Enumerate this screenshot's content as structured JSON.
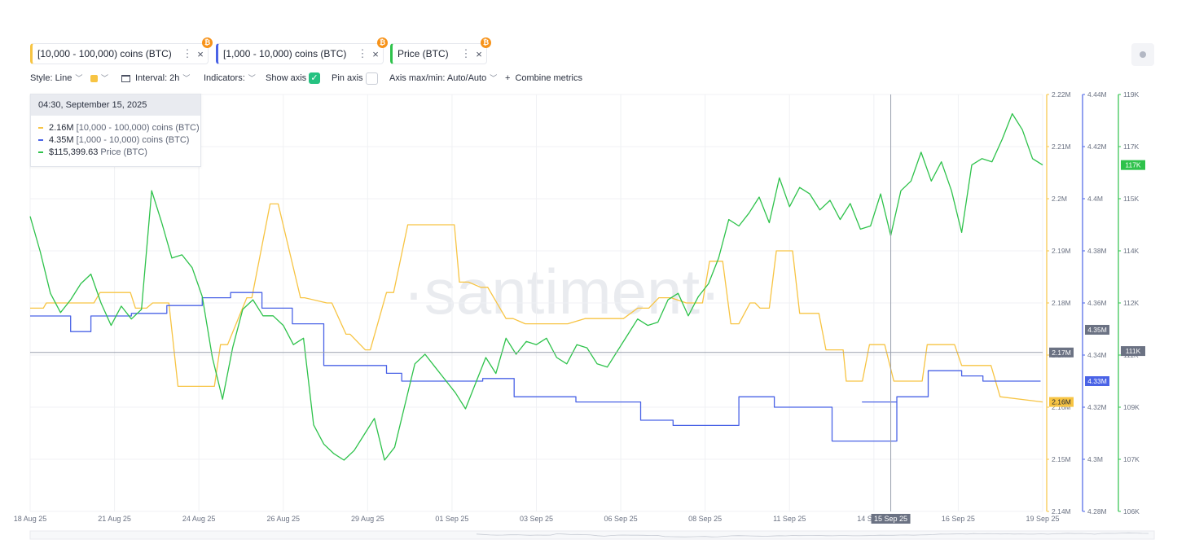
{
  "tabs": [
    {
      "label": "[10,000 - 100,000) coins (BTC)",
      "color": "#f7c443",
      "badge": "₿"
    },
    {
      "label": "[1,000 - 10,000) coins (BTC)",
      "color": "#4a63e6",
      "badge": "₿"
    },
    {
      "label": "Price (BTC)",
      "color": "#2ec24b",
      "badge": "₿"
    }
  ],
  "toolbar": {
    "style": "Style: Line",
    "interval": "Interval: 2h",
    "indicators": "Indicators:",
    "show_axis": "Show axis",
    "pin_axis": "Pin axis",
    "axis_maxmin": "Axis max/min: Auto/Auto",
    "combine": "Combine metrics"
  },
  "watermark": "·santiment·",
  "tooltip": {
    "date": "04:30, September 15, 2025",
    "rows": [
      {
        "value": "2.16M",
        "name": "[10,000 - 100,000) coins (BTC)",
        "color": "#f7c443"
      },
      {
        "value": "4.35M",
        "name": "[1,000 - 10,000) coins (BTC)",
        "color": "#4a63e6"
      },
      {
        "value": "$115,399.63",
        "name": "Price (BTC)",
        "color": "#2ec24b"
      }
    ]
  },
  "chart_data": {
    "type": "line",
    "x_ticks": [
      "18 Aug 25",
      "21 Aug 25",
      "24 Aug 25",
      "26 Aug 25",
      "29 Aug 25",
      "01 Sep 25",
      "03 Sep 25",
      "06 Sep 25",
      "08 Sep 25",
      "11 Sep 25",
      "14 Sep 25",
      "16 Sep 25",
      "19 Sep 25"
    ],
    "x_range": [
      "2025-08-18",
      "2025-09-19"
    ],
    "crosshair_label": "15 Sep 25",
    "axes": [
      {
        "series": "[10,000 - 100,000) coins (BTC)",
        "color": "#f7c443",
        "ticks": [
          "2.22M",
          "2.21M",
          "2.2M",
          "2.19M",
          "2.18M",
          "2.17M",
          "2.16M",
          "2.15M",
          "2.14M"
        ],
        "range": [
          2.14,
          2.22
        ],
        "unit": "M",
        "current": "2.16M",
        "crosshair": "2.17M"
      },
      {
        "series": "[1,000 - 10,000) coins (BTC)",
        "color": "#4a63e6",
        "ticks": [
          "4.44M",
          "4.42M",
          "4.4M",
          "4.38M",
          "4.36M",
          "4.34M",
          "4.32M",
          "4.3M",
          "4.28M"
        ],
        "range": [
          4.28,
          4.44
        ],
        "unit": "M",
        "current": "4.33M",
        "crosshair": "4.35M"
      },
      {
        "series": "Price (BTC)",
        "color": "#2ec24b",
        "ticks": [
          "119K",
          "117K",
          "115K",
          "114K",
          "112K",
          "111K",
          "109K",
          "107K",
          "106K"
        ],
        "range": [
          106,
          119
        ],
        "unit": "K",
        "current": "117K",
        "crosshair": "111K"
      }
    ],
    "series": [
      {
        "name": "[10,000 - 100,000) coins (BTC)",
        "color": "#f7c443",
        "axis": 0,
        "x": [
          0,
          1.3,
          1.6,
          4.5,
          5.1,
          6.3,
          6.9,
          9.9,
          10.4,
          11.5,
          12.1,
          13.7,
          14.6,
          15.9,
          16.9,
          18.2,
          18.8,
          19.5,
          21.4,
          21.9,
          23.7,
          24.5,
          26.7,
          27.1,
          29.3,
          29.8,
          31.2,
          31.6,
          33.1,
          33.6,
          35.2,
          35.9,
          37.3,
          37.8,
          38.9,
          39.6,
          40.4,
          41.9,
          42.4,
          43.3,
          44.5,
          45.2,
          47.0,
          47.7,
          48.9,
          49.3,
          52.8,
          53.1,
          54.8,
          55.2,
          57.5,
          58.6,
          60.0,
          61.1,
          62.1,
          63.3,
          64.8,
          66.4,
          67.1,
          68.4,
          69.2,
          70.0,
          71.1,
          71.6,
          72.1,
          73.0,
          73.7,
          75.3,
          76.0,
          77.9,
          78.6,
          80.3,
          80.6,
          82.2,
          82.9,
          84.4,
          85.3,
          88.1,
          88.6,
          91.3,
          92.0,
          94.9,
          95.8,
          100
        ],
        "y": [
          2.179,
          2.179,
          2.18,
          2.18,
          2.18,
          2.18,
          2.182,
          2.182,
          2.179,
          2.179,
          2.18,
          2.18,
          2.164,
          2.164,
          2.164,
          2.164,
          2.172,
          2.172,
          2.181,
          2.181,
          2.199,
          2.199,
          2.181,
          2.181,
          2.18,
          2.18,
          2.174,
          2.174,
          2.171,
          2.171,
          2.182,
          2.182,
          2.195,
          2.195,
          2.195,
          2.195,
          2.195,
          2.195,
          2.184,
          2.184,
          2.183,
          2.183,
          2.177,
          2.177,
          2.176,
          2.176,
          2.176,
          2.176,
          2.177,
          2.177,
          2.177,
          2.177,
          2.179,
          2.179,
          2.181,
          2.181,
          2.18,
          2.18,
          2.188,
          2.188,
          2.176,
          2.176,
          2.18,
          2.18,
          2.179,
          2.179,
          2.19,
          2.19,
          2.178,
          2.178,
          2.171,
          2.171,
          2.165,
          2.165,
          2.172,
          2.172,
          2.165,
          2.165,
          2.172,
          2.172,
          2.168,
          2.168,
          2.162,
          2.161
        ]
      },
      {
        "name": "[1,000 - 10,000) coins (BTC)",
        "color": "#4a63e6",
        "axis": 1,
        "x": [
          0,
          4.0,
          4.0,
          6.0,
          6.0,
          10.0,
          10.0,
          13.5,
          13.5,
          17.0,
          17.0,
          19.8,
          19.8,
          22.9,
          22.9,
          25.9,
          25.9,
          29.0,
          29.0,
          35.2,
          35.2,
          36.7,
          36.7,
          44.7,
          44.7,
          47.8,
          47.8,
          53.9,
          53.9,
          60.3,
          60.3,
          60.9,
          60.9,
          63.5,
          63.5,
          66.8,
          66.8,
          70.0,
          70.0,
          73.5,
          73.5,
          79.2,
          79.2,
          82.4,
          82.4,
          85.6,
          85.6,
          82.2,
          82.2,
          85.6,
          85.6,
          88.7,
          88.7,
          91.2,
          91.2,
          92.0,
          92.0,
          94.1,
          94.1,
          99.8
        ],
        "y": [
          4.355,
          4.355,
          4.349,
          4.349,
          4.355,
          4.355,
          4.356,
          4.356,
          4.359,
          4.359,
          4.362,
          4.362,
          4.364,
          4.364,
          4.358,
          4.358,
          4.352,
          4.352,
          4.336,
          4.336,
          4.333,
          4.333,
          4.33,
          4.33,
          4.331,
          4.331,
          4.324,
          4.324,
          4.322,
          4.322,
          4.315,
          4.315,
          4.315,
          4.315,
          4.313,
          4.313,
          4.313,
          4.313,
          4.324,
          4.324,
          4.32,
          4.32,
          4.307,
          4.307,
          4.307,
          4.307,
          4.322,
          4.322,
          4.322,
          4.322,
          4.324,
          4.324,
          4.334,
          4.334,
          4.334,
          4.334,
          4.332,
          4.332,
          4.33,
          4.33
        ]
      },
      {
        "name": "Price (BTC)",
        "color": "#2ec24b",
        "axis": 2,
        "x": [
          0,
          1,
          2,
          3,
          4,
          5,
          6,
          7,
          8,
          9,
          10,
          11,
          12,
          13,
          14,
          15,
          16,
          17,
          18,
          19,
          20,
          21,
          22,
          23,
          24,
          25,
          26,
          27,
          28,
          29,
          30,
          31,
          32,
          33,
          34,
          35,
          36,
          37,
          38,
          39,
          40,
          41,
          42,
          43,
          44,
          45,
          46,
          47,
          48,
          49,
          50,
          51,
          52,
          53,
          54,
          55,
          56,
          57,
          58,
          59,
          60,
          61,
          62,
          63,
          64,
          65,
          66,
          67,
          68,
          69,
          70,
          71,
          72,
          73,
          74,
          75,
          76,
          77,
          78,
          79,
          80,
          81,
          82,
          83,
          84,
          85,
          86,
          87,
          88,
          89,
          90,
          91,
          92,
          93,
          94,
          95,
          96,
          97,
          98,
          99,
          100
        ],
        "y": [
          115.2,
          114.1,
          112.8,
          112.2,
          112.6,
          113.1,
          113.4,
          112.5,
          111.8,
          112.4,
          112.0,
          112.3,
          116.0,
          115.0,
          113.9,
          114.0,
          113.6,
          112.7,
          110.8,
          109.5,
          111.1,
          112.3,
          112.6,
          112.1,
          112.1,
          111.8,
          111.2,
          111.4,
          108.7,
          108.1,
          107.8,
          107.6,
          107.9,
          108.4,
          108.9,
          107.6,
          108.0,
          109.3,
          110.6,
          110.9,
          110.5,
          110.1,
          109.7,
          109.2,
          110.0,
          110.8,
          110.3,
          111.4,
          110.9,
          111.3,
          111.2,
          111.4,
          110.8,
          110.6,
          111.2,
          111.1,
          110.6,
          110.5,
          111.0,
          111.5,
          112.0,
          111.8,
          111.9,
          112.6,
          112.8,
          112.1,
          112.7,
          113.1,
          113.9,
          115.1,
          114.9,
          115.3,
          115.8,
          115.0,
          116.4,
          115.5,
          116.1,
          115.9,
          115.4,
          115.7,
          115.1,
          115.6,
          114.8,
          114.9,
          115.9,
          114.6,
          116.0,
          116.3,
          117.2,
          116.3,
          116.9,
          116.0,
          114.7,
          116.8,
          117.0,
          116.9,
          117.6,
          118.4,
          117.9,
          117.0,
          116.8
        ]
      }
    ]
  }
}
